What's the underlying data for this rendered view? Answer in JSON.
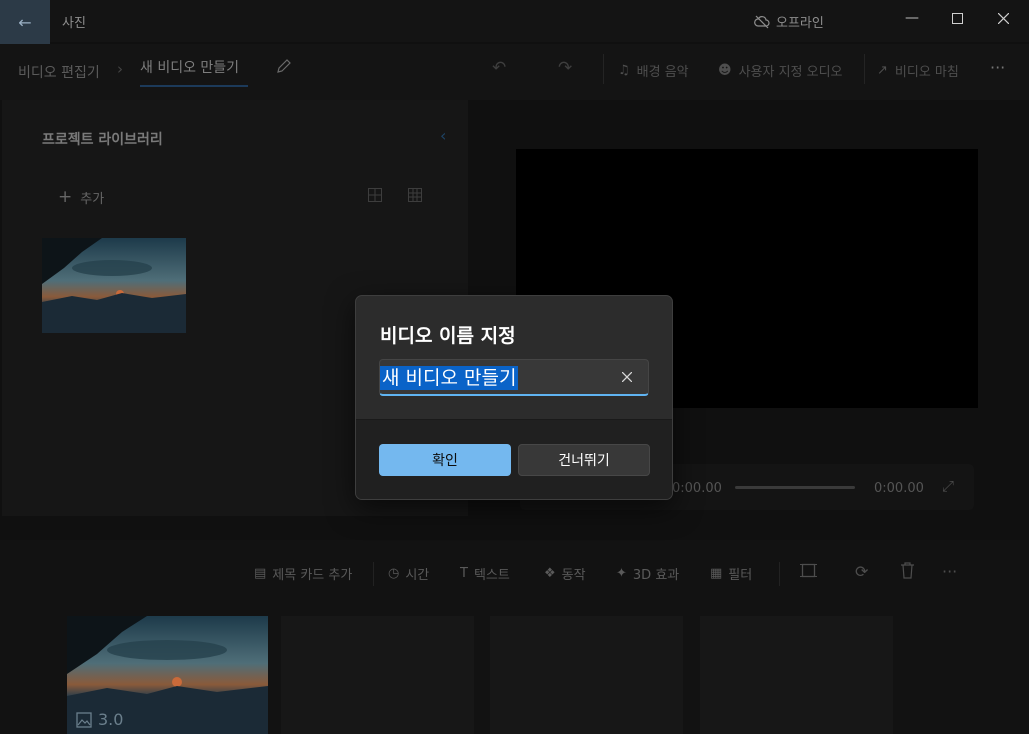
{
  "app": {
    "name": "사진",
    "offline_label": "오프라인"
  },
  "breadcrumb": {
    "parent": "비디오 편집기",
    "current": "새 비디오 만들기"
  },
  "toolbar": {
    "background_music": "배경 음악",
    "custom_audio": "사용자 지정 오디오",
    "finish_video": "비디오 마침",
    "more": "···"
  },
  "library": {
    "title": "프로젝트 라이브러리",
    "add_label": "추가"
  },
  "player": {
    "current_time": "0:00.00",
    "total_time": "0:00.00"
  },
  "storyboard": {
    "title_card": "제목 카드 추가",
    "duration": "시간",
    "text": "텍스트",
    "motion": "동작",
    "effects_3d": "3D 효과",
    "filters": "필터",
    "more": "···",
    "clips": [
      {
        "duration": "3.0"
      }
    ]
  },
  "dialog": {
    "title": "비디오 이름 지정",
    "input_value": "새 비디오 만들기",
    "confirm": "확인",
    "skip": "건너뛰기"
  },
  "colors": {
    "accent": "#74b8ef",
    "selection": "#0a63c8"
  }
}
